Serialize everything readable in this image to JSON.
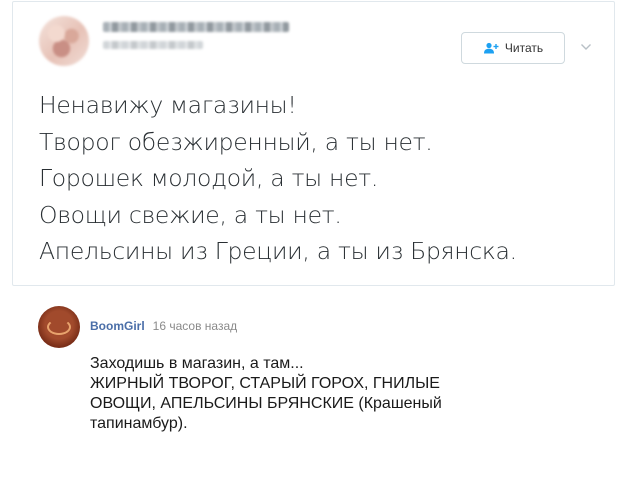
{
  "tweet": {
    "follow_label": "Читать",
    "lines": [
      "Ненавижу магазины!",
      "Творог обезжиренный, а ты нет.",
      "Горошек молодой, а ты нет.",
      "Овощи свежие, а ты нет.",
      "Апельсины из Греции, а ты из Брянска."
    ]
  },
  "comment": {
    "author": "BoomGirl",
    "time": "16 часов назад",
    "lines": [
      "Заходишь в магазин, а там...",
      "ЖИРНЫЙ ТВОРОГ, СТАРЫЙ ГОРОХ, ГНИЛЫЕ",
      "ОВОЩИ, АПЕЛЬСИНЫ БРЯНСКИЕ (Крашеный",
      "тапинамбур)."
    ]
  },
  "colors": {
    "follow_icon": "#1da1f2",
    "author_link": "#4a6ea8",
    "tweet_text": "#292f33",
    "card_border": "#e1e8ed"
  }
}
